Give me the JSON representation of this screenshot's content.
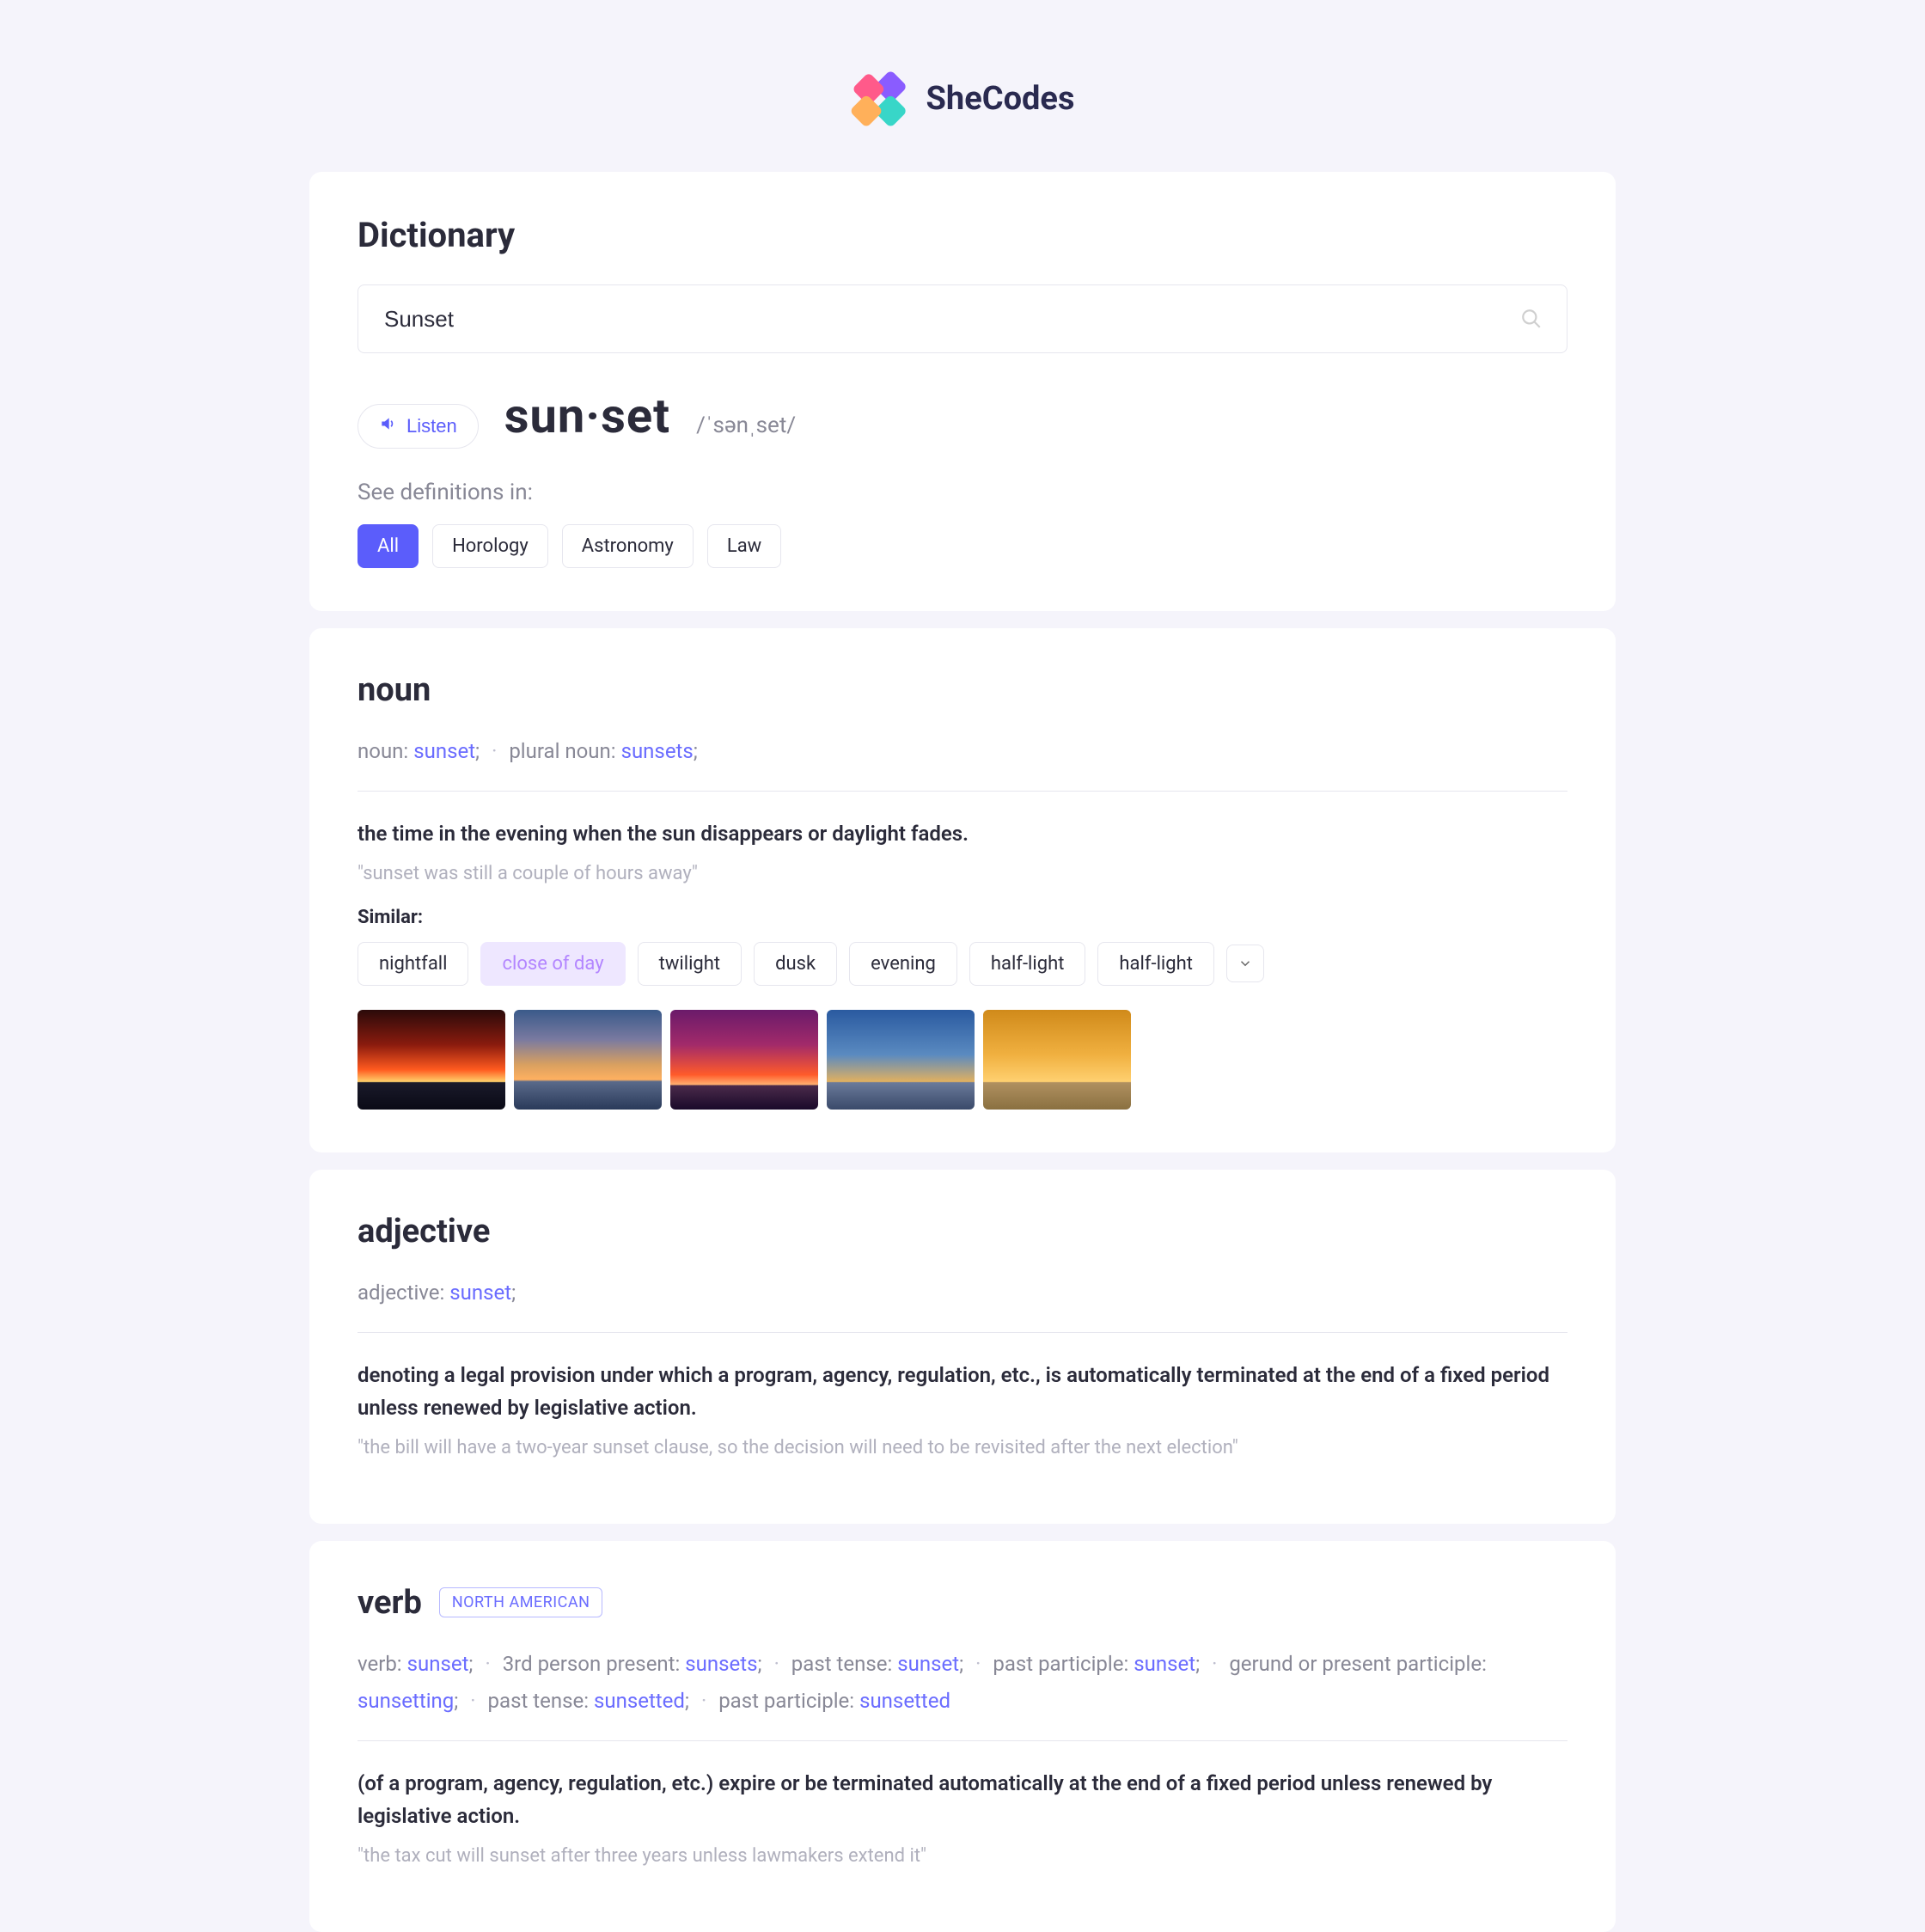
{
  "brand": {
    "name": "SheCodes"
  },
  "header": {
    "title": "Dictionary",
    "search_value": "Sunset",
    "listen_label": "Listen",
    "word_display": "sun·set",
    "phonetic": "/ˈsənˌset/",
    "defs_in_label": "See definitions in:",
    "tabs": [
      "All",
      "Horology",
      "Astronomy",
      "Law"
    ]
  },
  "noun": {
    "pos": "noun",
    "forms_parts": [
      {
        "t": "plain",
        "v": "noun: "
      },
      {
        "t": "kw",
        "v": "sunset"
      },
      {
        "t": "plain",
        "v": ";"
      },
      {
        "t": "sep",
        "v": "·"
      },
      {
        "t": "plain",
        "v": "plural noun: "
      },
      {
        "t": "kw",
        "v": "sunsets"
      },
      {
        "t": "plain",
        "v": ";"
      }
    ],
    "definition": "the time in the evening when the sun disappears or daylight fades.",
    "example": "\"sunset was still a couple of hours away\"",
    "similar_label": "Similar:",
    "similar": [
      {
        "label": "nightfall",
        "hl": false
      },
      {
        "label": "close of day",
        "hl": true
      },
      {
        "label": "twilight",
        "hl": false
      },
      {
        "label": "dusk",
        "hl": false
      },
      {
        "label": "evening",
        "hl": false
      },
      {
        "label": "half-light",
        "hl": false
      },
      {
        "label": "half-light",
        "hl": false
      }
    ]
  },
  "adjective": {
    "pos": "adjective",
    "forms_parts": [
      {
        "t": "plain",
        "v": "adjective: "
      },
      {
        "t": "kw",
        "v": "sunset"
      },
      {
        "t": "plain",
        "v": ";"
      }
    ],
    "definition": "denoting a legal provision under which a program, agency, regulation, etc., is automatically terminated at the end of a fixed period unless renewed by legislative action.",
    "example": "\"the bill will have a two-year sunset clause, so the decision will need to be revisited after the next election\""
  },
  "verb": {
    "pos": "verb",
    "region": "NORTH AMERICAN",
    "forms_parts": [
      {
        "t": "plain",
        "v": "verb: "
      },
      {
        "t": "kw",
        "v": "sunset"
      },
      {
        "t": "plain",
        "v": ";"
      },
      {
        "t": "sep",
        "v": "·"
      },
      {
        "t": "plain",
        "v": "3rd person present: "
      },
      {
        "t": "kw",
        "v": "sunsets"
      },
      {
        "t": "plain",
        "v": ";"
      },
      {
        "t": "sep",
        "v": "·"
      },
      {
        "t": "plain",
        "v": "past tense: "
      },
      {
        "t": "kw",
        "v": "sunset"
      },
      {
        "t": "plain",
        "v": ";"
      },
      {
        "t": "sep",
        "v": "·"
      },
      {
        "t": "plain",
        "v": "past participle: "
      },
      {
        "t": "kw",
        "v": "sunset"
      },
      {
        "t": "plain",
        "v": ";"
      },
      {
        "t": "sep",
        "v": "·"
      },
      {
        "t": "plain",
        "v": "gerund or present participle: "
      },
      {
        "t": "kw",
        "v": "sunsetting"
      },
      {
        "t": "plain",
        "v": ";"
      },
      {
        "t": "sep",
        "v": "·"
      },
      {
        "t": "plain",
        "v": "past tense: "
      },
      {
        "t": "kw",
        "v": "sunsetted"
      },
      {
        "t": "plain",
        "v": ";"
      },
      {
        "t": "sep",
        "v": "·"
      },
      {
        "t": "plain",
        "v": "past participle: "
      },
      {
        "t": "kw",
        "v": "sunsetted"
      }
    ],
    "definition": "(of a program, agency, regulation, etc.) expire or be terminated automatically at the end of a fixed period unless renewed by legislative action.",
    "example": "\"the tax cut will sunset after three years unless lawmakers extend it\""
  }
}
